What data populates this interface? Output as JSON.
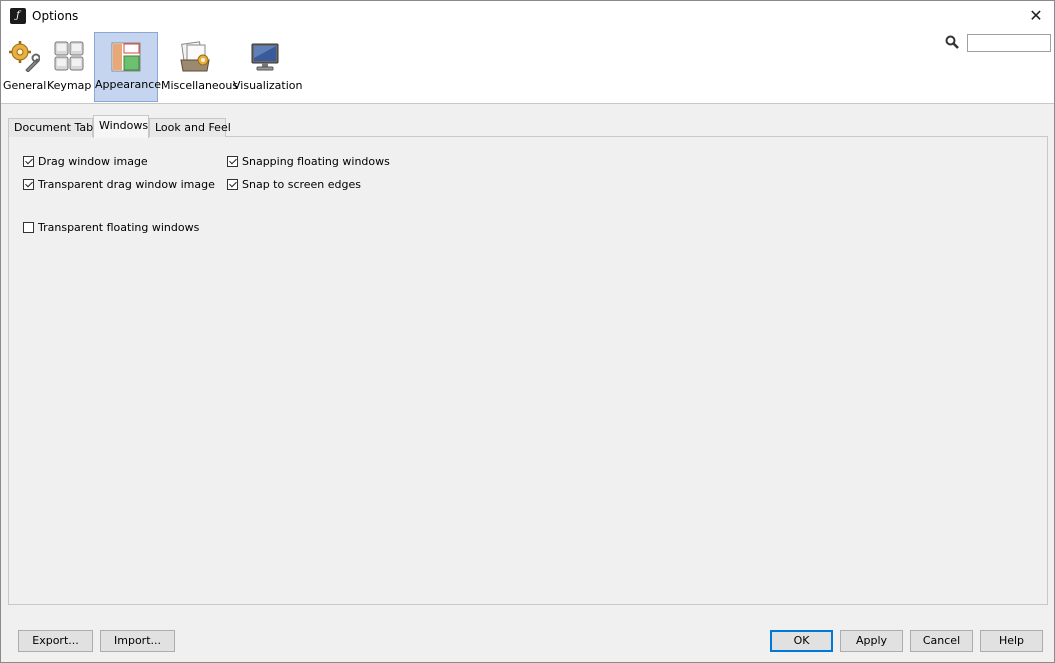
{
  "window": {
    "title": "Options"
  },
  "categories": [
    {
      "id": "general",
      "label": "General",
      "selected": false
    },
    {
      "id": "keymap",
      "label": "Keymap",
      "selected": false
    },
    {
      "id": "appearance",
      "label": "Appearance",
      "selected": true
    },
    {
      "id": "miscellaneous",
      "label": "Miscellaneous",
      "selected": false
    },
    {
      "id": "visualization",
      "label": "Visualization",
      "selected": false
    }
  ],
  "search": {
    "value": ""
  },
  "tabs": [
    {
      "label": "Document Tabs",
      "active": false
    },
    {
      "label": "Windows",
      "active": true
    },
    {
      "label": "Look and Feel",
      "active": false
    }
  ],
  "options": [
    {
      "label": "Drag window image",
      "checked": true
    },
    {
      "label": "Transparent drag window image",
      "checked": true
    },
    {
      "label": "Transparent floating windows",
      "checked": false
    },
    {
      "label": "Snapping floating windows",
      "checked": true
    },
    {
      "label": "Snap to screen edges",
      "checked": true
    }
  ],
  "buttons": {
    "export": "Export...",
    "import": "Import...",
    "ok": "OK",
    "apply": "Apply",
    "cancel": "Cancel",
    "help": "Help"
  }
}
